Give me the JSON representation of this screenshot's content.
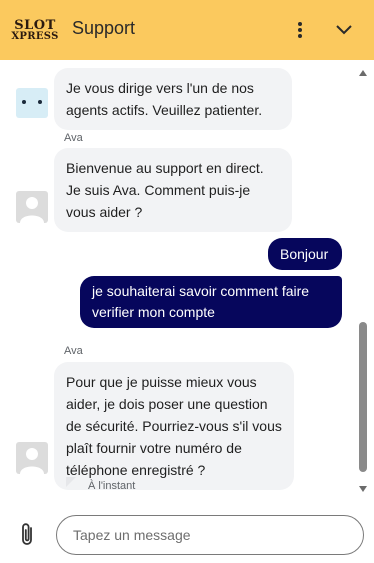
{
  "header": {
    "logo_line1": "SLOT",
    "logo_line2": "XPRESS",
    "title": "Support",
    "menu_icon": "more-vertical-icon",
    "collapse_icon": "chevron-down-icon",
    "background": "#fbc95e"
  },
  "messages": [
    {
      "from": "bot",
      "sender": "",
      "text": "Je vous dirige vers l'un de nos agents actifs. Veuillez patienter."
    },
    {
      "from": "agent",
      "sender": "Ava",
      "text": "Bienvenue au support en direct. Je suis Ava. Comment puis-je vous aider ?"
    },
    {
      "from": "user",
      "sender": "",
      "text": "Bonjour"
    },
    {
      "from": "user",
      "sender": "",
      "text": "je souhaiterai savoir comment faire verifier mon compte"
    },
    {
      "from": "agent",
      "sender": "Ava",
      "text": "Pour que je puisse mieux vous aider, je dois poser une question de sécurité. Pourriez-vous s'il vous plaît fournir votre numéro de téléphone enregistré ?"
    }
  ],
  "timestamp": "À l'instant",
  "composer": {
    "placeholder": "Tapez un message",
    "attach_icon": "paperclip-icon"
  },
  "colors": {
    "user_bubble": "#06065c",
    "agent_bubble": "#f2f3f5"
  }
}
